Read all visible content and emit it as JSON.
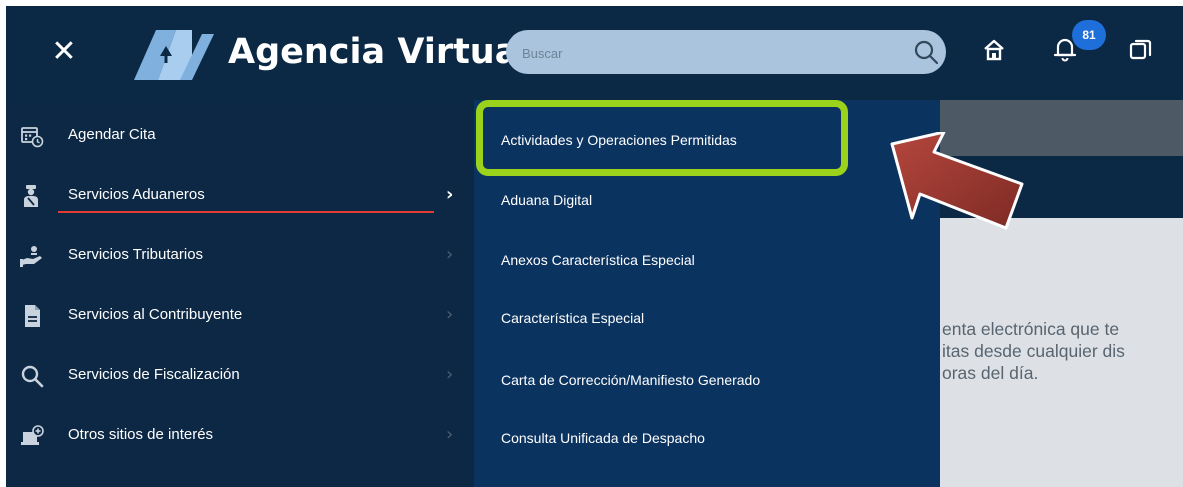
{
  "header": {
    "brand": "Agencia Virtual",
    "search_placeholder": "Buscar",
    "notification_count": "81"
  },
  "sidebar": {
    "items": [
      {
        "label": "Agendar Cita",
        "icon": "calendar-clock-icon"
      },
      {
        "label": "Servicios Aduaneros",
        "icon": "customs-officer-icon",
        "active": true
      },
      {
        "label": "Servicios Tributarios",
        "icon": "hand-coins-icon"
      },
      {
        "label": "Servicios al Contribuyente",
        "icon": "document-icon"
      },
      {
        "label": "Servicios de Fiscalización",
        "icon": "magnifier-icon"
      },
      {
        "label": "Otros sitios de interés",
        "icon": "laptop-plus-icon"
      }
    ]
  },
  "submenu": {
    "items": [
      {
        "label": "Actividades y Operaciones Permitidas",
        "highlighted": true
      },
      {
        "label": "Aduana Digital"
      },
      {
        "label": "Anexos Característica Especial"
      },
      {
        "label": "Característica Especial"
      },
      {
        "label": "Carta de Corrección/Manifiesto Generado"
      },
      {
        "label": "Consulta Unificada de Despacho"
      }
    ]
  },
  "content": {
    "lines": [
      "enta electrónica que te",
      "itas desde cualquier dis",
      "oras del día."
    ]
  },
  "colors": {
    "topbar": "#0b2844",
    "sidebar": "#0d2844",
    "submenu": "#0b3360",
    "highlight": "#9bd21c",
    "arrow": "#a33a32",
    "underline": "#e03c31"
  }
}
